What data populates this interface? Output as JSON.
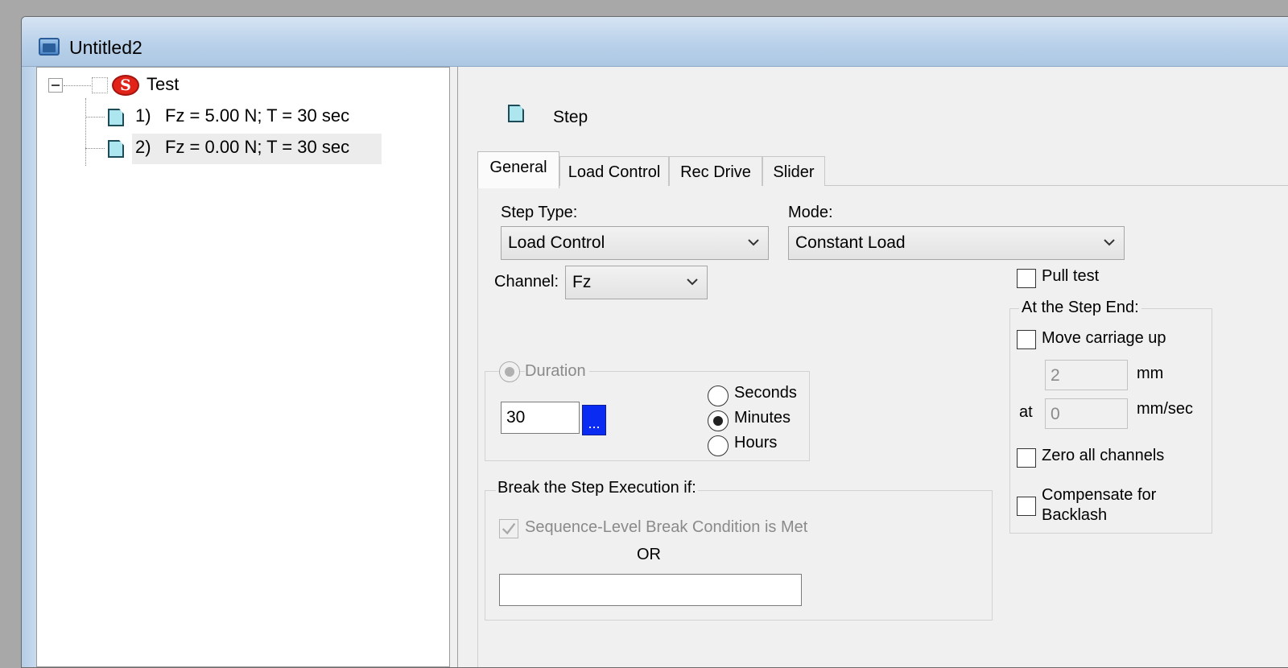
{
  "window": {
    "title": "Untitled2"
  },
  "tree": {
    "root_label": "Test",
    "root_icon": "s-icon",
    "items": [
      {
        "index": "1)",
        "label": "Fz = 5.00 N; T = 30 sec"
      },
      {
        "index": "2)",
        "label": "Fz = 0.00 N; T = 30 sec"
      }
    ]
  },
  "panel": {
    "header": "Step",
    "tabs": [
      "General",
      "Load Control",
      "Rec Drive",
      "Slider"
    ],
    "active_tab": "General"
  },
  "general": {
    "step_type_label": "Step Type:",
    "step_type_value": "Load Control",
    "mode_label": "Mode:",
    "mode_value": "Constant Load",
    "channel_label": "Channel:",
    "channel_value": "Fz",
    "pull_test_label": "Pull test",
    "duration": {
      "label": "Duration",
      "value": "30",
      "browse_label": "...",
      "units": [
        "Seconds",
        "Minutes",
        "Hours"
      ],
      "selected_unit": "Minutes"
    },
    "break": {
      "label": "Break the Step Execution if:",
      "sequence_label": "Sequence-Level Break Condition is Met",
      "or_label": "OR",
      "condition_value": ""
    },
    "step_end": {
      "label": "At the Step End:",
      "move_carriage_label": "Move carriage up",
      "distance_value": "2",
      "distance_unit": "mm",
      "at_label": "at",
      "speed_value": "0",
      "speed_unit": "mm/sec",
      "zero_channels_label": "Zero all channels",
      "compensate_line1": "Compensate for",
      "compensate_line2": "Backlash"
    }
  }
}
